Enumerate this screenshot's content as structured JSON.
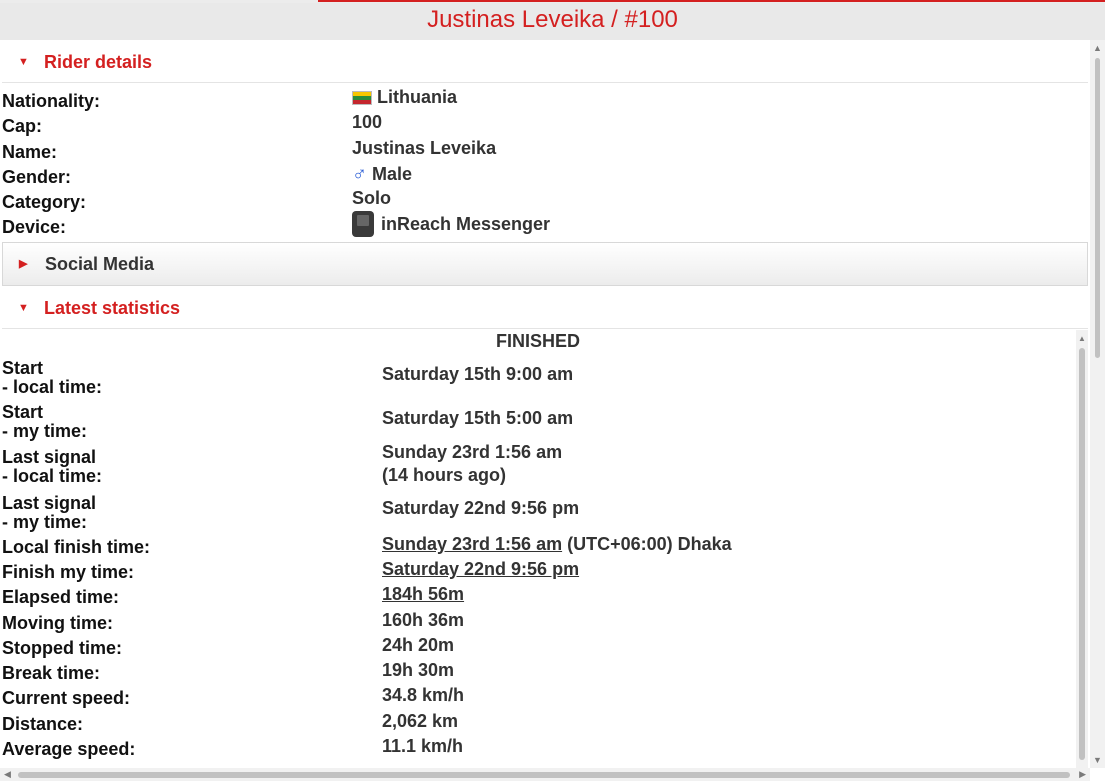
{
  "page": {
    "title": "Justinas Leveika / #100",
    "accent_color": "#d42020"
  },
  "rider_details": {
    "header": "Rider details",
    "rows": [
      {
        "label": "Nationality:",
        "value": "Lithuania",
        "icon": "lithuania-flag-icon"
      },
      {
        "label": "Cap:",
        "value": "100"
      },
      {
        "label": "Name:",
        "value": "Justinas Leveika"
      },
      {
        "label": "Gender:",
        "value": "Male",
        "icon": "male-symbol-icon",
        "icon_glyph": "♂"
      },
      {
        "label": "Category:",
        "value": "Solo"
      },
      {
        "label": "Device:",
        "value": "inReach Messenger",
        "icon": "inreach-device-icon"
      }
    ]
  },
  "social_media": {
    "header": "Social Media"
  },
  "latest_statistics": {
    "header": "Latest statistics",
    "status": "FINISHED",
    "start_local": {
      "label": "Start",
      "sub": "- local time:",
      "value": "Saturday 15th 9:00 am"
    },
    "start_my": {
      "label": "Start",
      "sub": "- my time:",
      "value": "Saturday 15th 5:00 am"
    },
    "last_signal_local": {
      "label": "Last signal",
      "sub": "- local time:",
      "value": "Sunday 23rd 1:56 am",
      "extra": "(14 hours ago)"
    },
    "last_signal_my": {
      "label": "Last signal",
      "sub": "- my time:",
      "value": "Saturday 22nd 9:56 pm"
    },
    "local_finish": {
      "label": "Local finish time:",
      "value": "Sunday 23rd 1:56 am",
      "suffix": " (UTC+06:00) Dhaka"
    },
    "finish_my": {
      "label": "Finish my time:",
      "value": "Saturday 22nd 9:56 pm"
    },
    "elapsed": {
      "label": "Elapsed time:",
      "value": "184h 56m"
    },
    "moving": {
      "label": "Moving time:",
      "value": "160h 36m"
    },
    "stopped": {
      "label": "Stopped time:",
      "value": "24h 20m"
    },
    "break": {
      "label": "Break time:",
      "value": "19h 30m"
    },
    "current_speed": {
      "label": "Current speed:",
      "value": "34.8 km/h"
    },
    "distance": {
      "label": "Distance:",
      "value": "2,062 km"
    },
    "average_speed": {
      "label": "Average speed:",
      "value": "11.1 km/h"
    }
  },
  "scrollbar": {
    "up_glyph": "▲",
    "down_glyph": "▼",
    "left_glyph": "◀",
    "right_glyph": "▶"
  },
  "glyphs": {
    "caret_down": "▼",
    "caret_right": "▶"
  }
}
